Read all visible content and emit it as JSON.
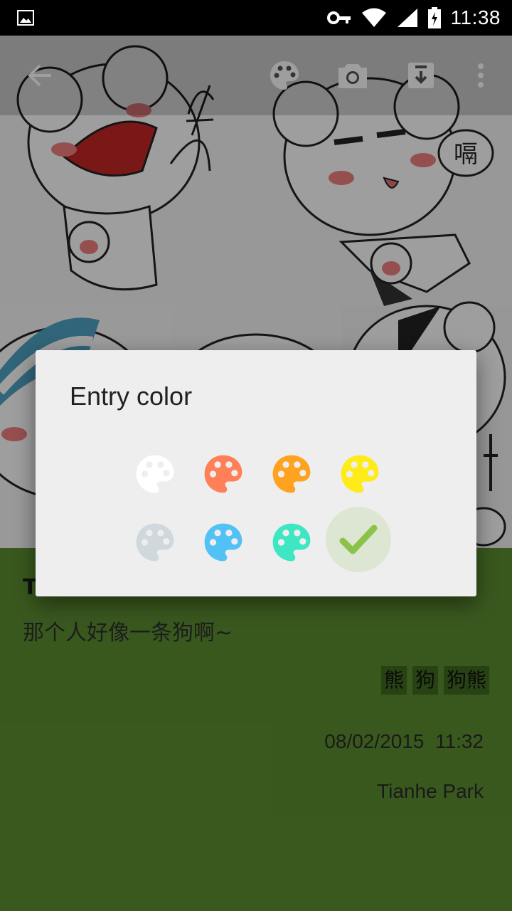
{
  "status_bar": {
    "time": "11:38",
    "icons": [
      "image-icon",
      "key-icon",
      "wifi-icon",
      "signal-icon",
      "battery-charging-icon"
    ]
  },
  "toolbar": {
    "icons": [
      "back-arrow-icon",
      "palette-icon",
      "camera-icon",
      "download-icon",
      "more-vert-icon"
    ]
  },
  "photo": {
    "caption_glyph": "嗝"
  },
  "entry": {
    "title": "T",
    "body": "那个人好像一条狗啊~",
    "tags": [
      "熊",
      "狗",
      "狗熊"
    ],
    "date": "08/02/2015",
    "time": "11:32",
    "location": "Tianhe Park",
    "background_color": "#5d8f31"
  },
  "dialog": {
    "title": "Entry color",
    "swatches": [
      {
        "color": "#ffffff",
        "icon": "palette-icon",
        "selected": false
      },
      {
        "color": "#ff7f57",
        "icon": "palette-icon",
        "selected": false
      },
      {
        "color": "#ffa21f",
        "icon": "palette-icon",
        "selected": false
      },
      {
        "color": "#ffeb1a",
        "icon": "palette-icon",
        "selected": false
      },
      {
        "color": "#cfd8dc",
        "icon": "palette-icon",
        "selected": false
      },
      {
        "color": "#52c1f6",
        "icon": "palette-icon",
        "selected": false
      },
      {
        "color": "#3fe6c3",
        "icon": "palette-icon",
        "selected": false
      },
      {
        "color": "#8bc34a",
        "icon": "check-icon",
        "selected": true
      }
    ]
  }
}
